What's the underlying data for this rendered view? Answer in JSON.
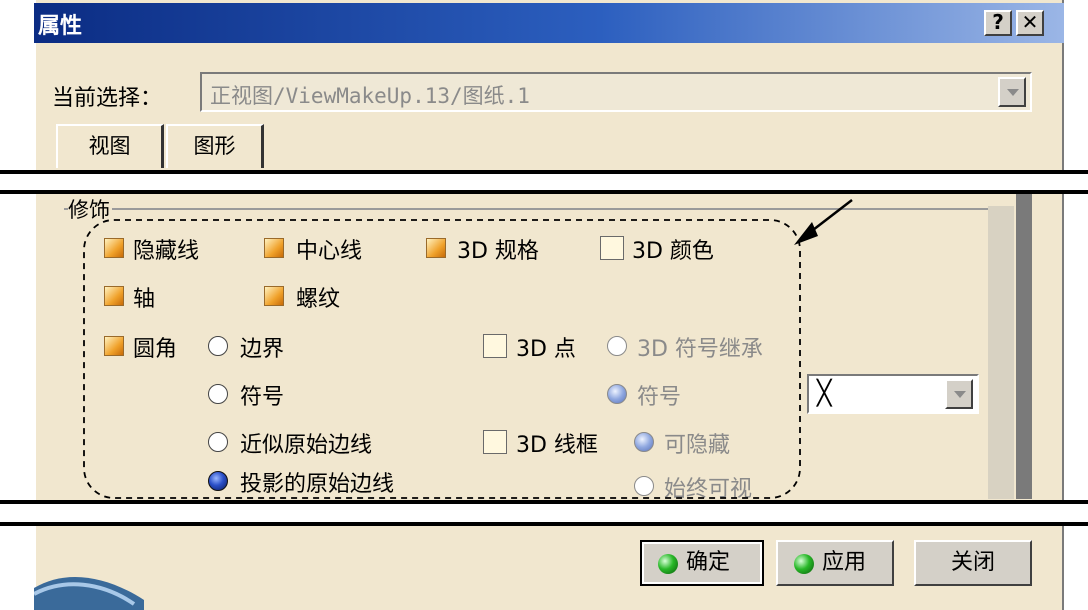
{
  "window": {
    "title": "属性",
    "help_label": "?",
    "close_label": "✕"
  },
  "selection": {
    "label": "当前选择：",
    "value": "正视图/ViewMakeUp.13/图纸.1"
  },
  "tabs": [
    {
      "label": "视图",
      "active": true
    },
    {
      "label": "图形",
      "active": false
    }
  ],
  "group": {
    "label": "修饰",
    "checkboxes": {
      "hidden_lines": {
        "label": "隐藏线",
        "checked": true
      },
      "center_lines": {
        "label": "中心线",
        "checked": true
      },
      "spec_3d": {
        "label": "3D 规格",
        "checked": true
      },
      "color_3d": {
        "label": "3D 颜色",
        "checked": false
      },
      "axis": {
        "label": "轴",
        "checked": true
      },
      "thread": {
        "label": "螺纹",
        "checked": true
      },
      "fillet": {
        "label": "圆角",
        "checked": true
      },
      "points_3d": {
        "label": "3D 点",
        "checked": false
      },
      "wireframe_3d": {
        "label": "3D 线框",
        "checked": false
      }
    },
    "fillet_options": [
      {
        "label": "边界",
        "selected": false
      },
      {
        "label": "符号",
        "selected": false
      },
      {
        "label": "近似原始边线",
        "selected": false
      },
      {
        "label": "投影的原始边线",
        "selected": true
      }
    ],
    "points_options": [
      {
        "label": "3D 符号继承",
        "selected": false
      },
      {
        "label": "符号",
        "selected": true
      }
    ],
    "symbol_select": {
      "value": "╳"
    },
    "wireframe_options": [
      {
        "label": "可隐藏",
        "selected": true
      },
      {
        "label": "始终可视",
        "selected": false
      }
    ]
  },
  "buttons": {
    "ok": "确定",
    "apply": "应用",
    "close": "关闭"
  },
  "colors": {
    "title_bar": "#0b2c83",
    "dialog_bg": "#f1e7cf",
    "checkbox_on": "#f0a12a"
  }
}
